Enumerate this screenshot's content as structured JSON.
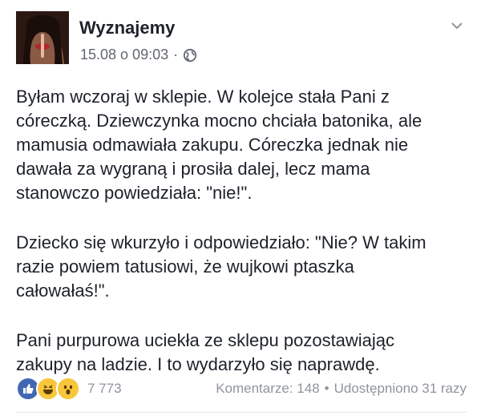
{
  "post": {
    "page_name": "Wyznajemy",
    "timestamp": "15.08 o 09:03",
    "separator": "·",
    "privacy_icon": "globe-icon",
    "options_icon": "chevron-down-icon",
    "paragraphs": [
      "Byłam wczoraj w sklepie. W kolejce stała Pani z\ncóreczką. Dziewczynka mocno chciała batonika, ale\nmamusia odmawiała zakupu. Córeczka jednak nie\ndawała za wygraną i prosiła dalej, lecz mama\nstanowczo powiedziała: \"nie!\".",
      "Dziecko się wkurzyło i odpowiedziało: \"Nie? W takim\nrazie powiem tatusiowi, że wujkowi ptaszka\ncałowałaś!\".",
      "Pani purpurowa uciekła ze sklepu pozostawiając\nzakupy na ladzie. I to wydarzyło się naprawdę."
    ]
  },
  "footer": {
    "reactions": [
      "like-icon",
      "haha-icon",
      "wow-icon"
    ],
    "reaction_count": "7 773",
    "comments": "Komentarze: 148",
    "separator": "•",
    "shares": "Udostępniono 31 razy"
  },
  "colors": {
    "text": "#1d2129",
    "meta": "#606770",
    "footer": "#90949c",
    "like": "#4267b2",
    "emoji": "#f7c63b"
  }
}
